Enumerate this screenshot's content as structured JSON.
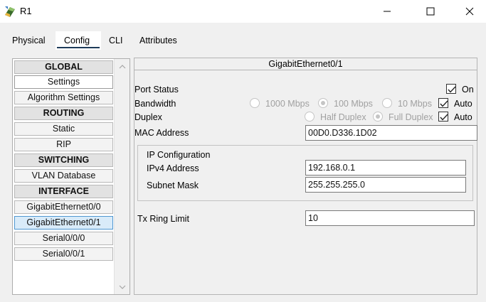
{
  "window": {
    "title": "R1",
    "icon": "router-app-icon"
  },
  "tabs": [
    {
      "label": "Physical",
      "active": false
    },
    {
      "label": "Config",
      "active": true
    },
    {
      "label": "CLI",
      "active": false
    },
    {
      "label": "Attributes",
      "active": false
    }
  ],
  "sidebar": {
    "items": [
      {
        "label": "GLOBAL",
        "kind": "header"
      },
      {
        "label": "Settings",
        "kind": "item"
      },
      {
        "label": "Algorithm Settings",
        "kind": "item"
      },
      {
        "label": "ROUTING",
        "kind": "header"
      },
      {
        "label": "Static",
        "kind": "item"
      },
      {
        "label": "RIP",
        "kind": "item"
      },
      {
        "label": "SWITCHING",
        "kind": "header"
      },
      {
        "label": "VLAN Database",
        "kind": "item"
      },
      {
        "label": "INTERFACE",
        "kind": "header"
      },
      {
        "label": "GigabitEthernet0/0",
        "kind": "item"
      },
      {
        "label": "GigabitEthernet0/1",
        "kind": "item",
        "selected": true
      },
      {
        "label": "Serial0/0/0",
        "kind": "item"
      },
      {
        "label": "Serial0/0/1",
        "kind": "item"
      }
    ]
  },
  "interface": {
    "title": "GigabitEthernet0/1",
    "port_status": {
      "label": "Port Status",
      "on_label": "On",
      "on_checked": true
    },
    "bandwidth": {
      "label": "Bandwidth",
      "options": [
        "1000 Mbps",
        "100 Mbps",
        "10 Mbps"
      ],
      "selected": "100 Mbps",
      "auto_label": "Auto",
      "auto_checked": true
    },
    "duplex": {
      "label": "Duplex",
      "options": [
        "Half Duplex",
        "Full Duplex"
      ],
      "selected": "Full Duplex",
      "auto_label": "Auto",
      "auto_checked": true
    },
    "mac": {
      "label": "MAC Address",
      "value": "00D0.D336.1D02"
    },
    "ip_config": {
      "group_label": "IP Configuration",
      "ipv4_label": "IPv4 Address",
      "ipv4_value": "192.168.0.1",
      "mask_label": "Subnet Mask",
      "mask_value": "255.255.255.0"
    },
    "tx_ring": {
      "label": "Tx Ring Limit",
      "value": "10"
    }
  },
  "colors": {
    "selected_bg": "#d9ebf9",
    "selected_border": "#4f97d1",
    "tab_underline": "#1e3c5a"
  }
}
